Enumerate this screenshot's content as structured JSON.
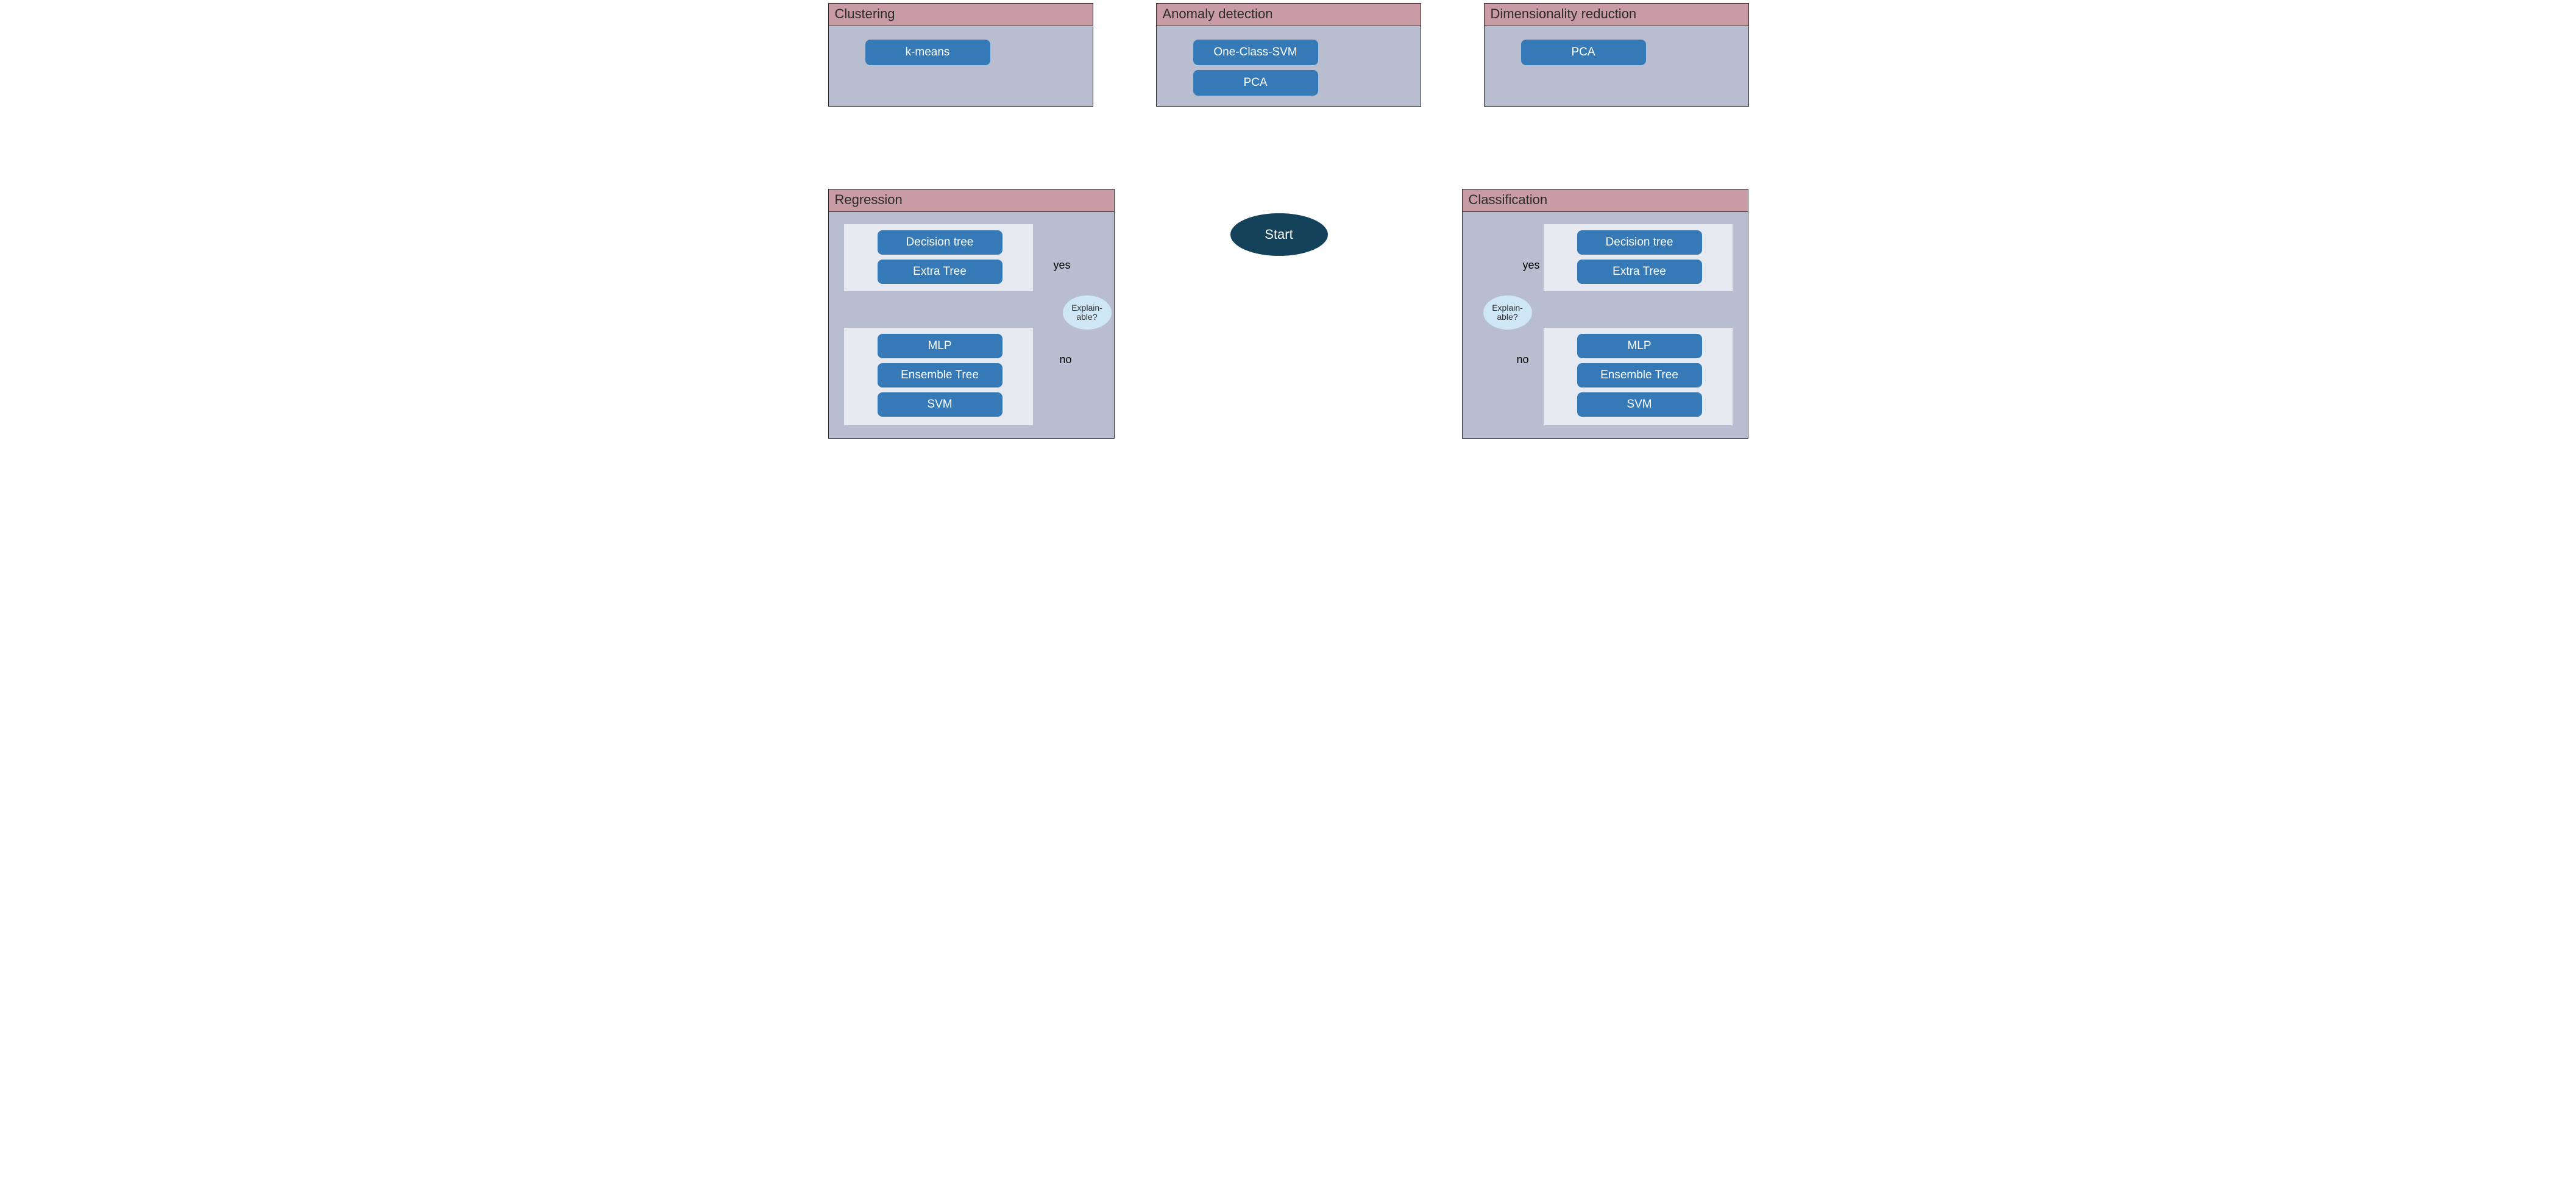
{
  "start": {
    "label": "Start"
  },
  "decision": {
    "label": "Explain-\nable?"
  },
  "labels": {
    "yes": "yes",
    "no": "no"
  },
  "panels": {
    "clustering": {
      "title": "Clustering",
      "items": [
        "k-means"
      ]
    },
    "anomaly": {
      "title": "Anomaly detection",
      "items": [
        "One-Class-SVM",
        "PCA"
      ]
    },
    "dimred": {
      "title": "Dimensionality reduction",
      "items": [
        "PCA"
      ]
    },
    "regression": {
      "title": "Regression",
      "yes_group": [
        "Decision tree",
        "Extra Tree"
      ],
      "no_group": [
        "MLP",
        "Ensemble Tree",
        "SVM"
      ]
    },
    "classification": {
      "title": "Classification",
      "yes_group": [
        "Decision tree",
        "Extra Tree"
      ],
      "no_group": [
        "MLP",
        "Ensemble Tree",
        "SVM"
      ]
    }
  }
}
